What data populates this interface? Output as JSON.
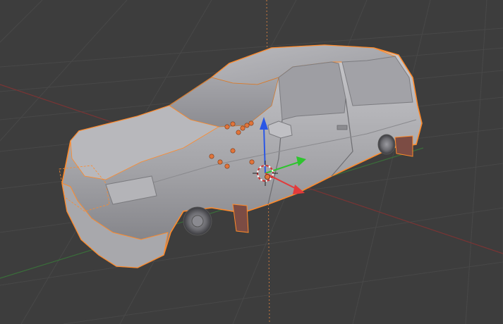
{
  "viewport": {
    "background": "#3d3d3d",
    "grid_color": "#4a4a4a",
    "x_axis_color": "#8a3a3a",
    "y_axis_color": "#3f7a3f",
    "z_axis_color": "#c87a40"
  },
  "scene": {
    "object_name": "",
    "selection_outline_color": "#ff8a2a",
    "body_color": "#a9a9ad",
    "tire_color": "#6e4a40",
    "vertex_color": "#e0743a"
  },
  "gizmo": {
    "x_arrow_color": "#e33a3a",
    "y_arrow_color": "#2ec42e",
    "z_arrow_color": "#2a57e6",
    "cursor_icon": "3d-cursor-icon"
  }
}
